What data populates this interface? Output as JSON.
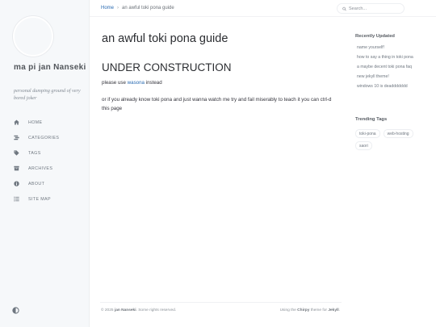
{
  "sidebar": {
    "title": "ma pi jan Nanseki",
    "subtitle": "personal dumping ground of very bored joker",
    "nav": [
      {
        "label": "HOME",
        "icon": "home-icon"
      },
      {
        "label": "CATEGORIES",
        "icon": "stream-icon"
      },
      {
        "label": "TAGS",
        "icon": "tag-icon"
      },
      {
        "label": "ARCHIVES",
        "icon": "archive-icon"
      },
      {
        "label": "ABOUT",
        "icon": "info-icon"
      },
      {
        "label": "SITE MAP",
        "icon": "list-icon"
      }
    ],
    "mode_toggle_icon": "theme-toggle-icon"
  },
  "topbar": {
    "breadcrumb_home": "Home",
    "breadcrumb_separator": "›",
    "breadcrumb_current": "an awful toki pona guide",
    "search_placeholder": "Search..."
  },
  "main": {
    "title": "an awful toki pona guide",
    "section_heading": "UNDER CONSTRUCTION",
    "para1_prefix": "please use ",
    "para1_link": "wasona",
    "para1_suffix": " instead",
    "para2": "or if you already know toki pona and just wanna watch me try and fail miserably to teach it you can ctrl-d this page"
  },
  "panel": {
    "recent_heading": "Recently Updated",
    "recent_items": [
      "name yourself!",
      "how to say a thing in toki pona",
      "a maybe decent toki pona faq",
      "new jekyll theme!",
      "windows 10 is deaddddddd"
    ],
    "tags_heading": "Trending Tags",
    "tags": [
      "toki-pona",
      "web-hosting",
      "saori"
    ]
  },
  "footer": {
    "left_prefix": "© 2025 ",
    "left_name": "jan Nanseki",
    "left_suffix": ". Some rights reserved.",
    "right_prefix": "Using the ",
    "right_theme": "Chirpy",
    "right_middle": " theme for ",
    "right_engine": "Jekyll",
    "right_suffix": "."
  },
  "colors": {
    "accent_link": "#2a6bb2",
    "sidebar_bg": "#f6f8fa",
    "text": "#34343c"
  }
}
